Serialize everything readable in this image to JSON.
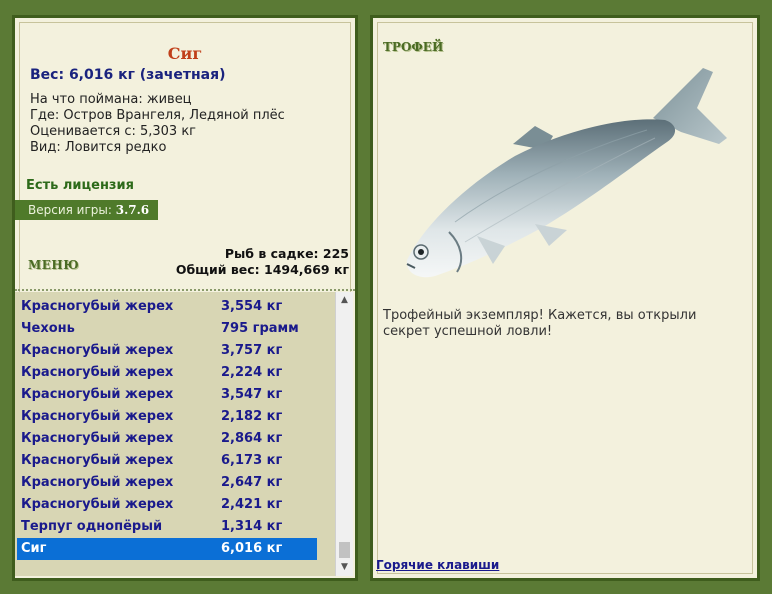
{
  "fish": {
    "title": "Сиг",
    "weight_line": "Вес: 6,016 кг (зачетная)",
    "info": [
      "На что поймана: живец",
      "Где: Остров Врангеля, Ледяной плёс",
      "Оценивается с: 5,303 кг",
      "Вид: Ловится редко"
    ]
  },
  "license": "Есть лицензия",
  "version": {
    "label": "Версия игры:",
    "value": "3.7.6"
  },
  "menu_label": "МЕНЮ",
  "stats": {
    "fish_count": "Рыб в садке: 225",
    "total_weight": "Общий вес: 1494,669 кг"
  },
  "catch_list": [
    {
      "name": "Красногубый жерех",
      "weight": "3,554 кг"
    },
    {
      "name": "Чехонь",
      "weight": "795 грамм"
    },
    {
      "name": "Красногубый жерех",
      "weight": "3,757 кг"
    },
    {
      "name": "Красногубый жерех",
      "weight": "2,224 кг"
    },
    {
      "name": "Красногубый жерех",
      "weight": "3,547 кг"
    },
    {
      "name": "Красногубый жерех",
      "weight": "2,182 кг"
    },
    {
      "name": "Красногубый жерех",
      "weight": "2,864 кг"
    },
    {
      "name": "Красногубый жерех",
      "weight": "6,173 кг"
    },
    {
      "name": "Красногубый жерех",
      "weight": "2,647 кг"
    },
    {
      "name": "Красногубый жерех",
      "weight": "2,421 кг"
    },
    {
      "name": "Терпуг однопёрый",
      "weight": "1,314 кг"
    },
    {
      "name": "Сиг",
      "weight": "6,016 кг",
      "selected": true
    }
  ],
  "trophy": {
    "label": "ТРОФЕЙ",
    "text": "Трофейный экземпляр! Кажется, вы открыли секрет успешной ловли!"
  },
  "hotkeys_label": "Горячие клавиши",
  "colors": {
    "background": "#5b7a35",
    "panel": "#f3f1dd",
    "selected_row": "#0b6fd6",
    "list_text": "#1a1a8c",
    "title": "#c0401a"
  }
}
